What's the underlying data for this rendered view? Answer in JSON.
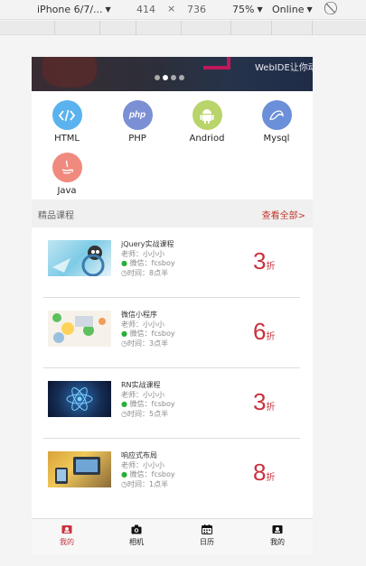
{
  "devtools": {
    "device": "iPhone 6/7/...",
    "width": "414",
    "times": "×",
    "height": "736",
    "zoom": "75%",
    "network": "Online"
  },
  "banner": {
    "text": "WebIDE让你动",
    "slide_count": 4,
    "active_slide": 2
  },
  "categories": [
    {
      "label": "HTML",
      "icon": "code-icon",
      "color": "#5ab3ee"
    },
    {
      "label": "PHP",
      "icon": "php-icon",
      "color": "#7b8fd4"
    },
    {
      "label": "Andriod",
      "icon": "android-icon",
      "color": "#b8d46a"
    },
    {
      "label": "Mysql",
      "icon": "mysql-icon",
      "color": "#6b8fd8"
    },
    {
      "label": "Java",
      "icon": "java-icon",
      "color": "#f08a7e"
    }
  ],
  "section": {
    "title": "精品课程",
    "more": "查看全部>"
  },
  "courses": [
    {
      "title": "jQuery实战课程",
      "teacher": "老师：小小小",
      "wechat": "微信：fcsboy",
      "time": "时间：8点半",
      "discount": "3",
      "unit": "折"
    },
    {
      "title": "微信小程序",
      "teacher": "老师：小小小",
      "wechat": "微信：fcsboy",
      "time": "时间：3点半",
      "discount": "6",
      "unit": "折"
    },
    {
      "title": "RN实战课程",
      "teacher": "老师：小小小",
      "wechat": "微信：fcsboy",
      "time": "时间：5点半",
      "discount": "3",
      "unit": "折"
    },
    {
      "title": "响应式布局",
      "teacher": "老师：小小小",
      "wechat": "微信：fcsboy",
      "time": "时间：1点半",
      "discount": "8",
      "unit": "折"
    }
  ],
  "tabs": [
    {
      "label": "我的",
      "icon": "user-card-icon",
      "active": true
    },
    {
      "label": "相机",
      "icon": "camera-icon",
      "active": false
    },
    {
      "label": "日历",
      "icon": "calendar-icon",
      "active": false
    },
    {
      "label": "我的",
      "icon": "user-card-icon",
      "active": false
    }
  ],
  "colors": {
    "accent": "#c9313e",
    "wechat": "#2aae3a"
  }
}
